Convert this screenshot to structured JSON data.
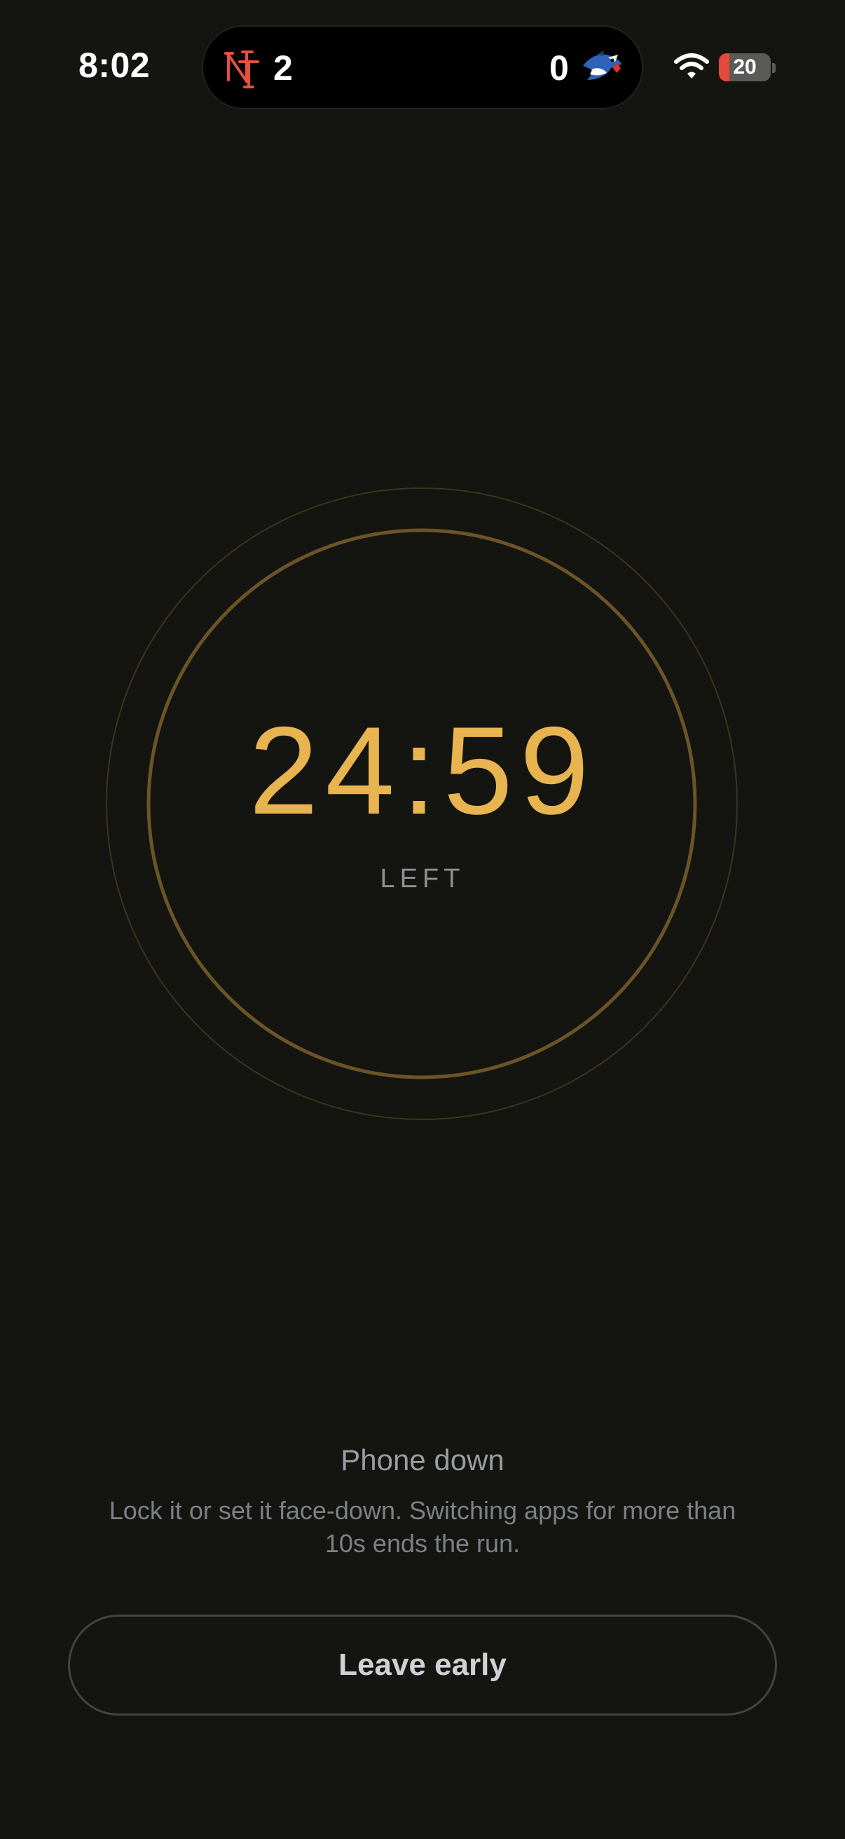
{
  "status_bar": {
    "time": "8:02",
    "wifi_icon": "wifi-icon",
    "battery_level": "20"
  },
  "live_activity": {
    "left_team_icon": "mets-logo",
    "left_score": "2",
    "right_score": "0",
    "right_team_icon": "blue-jays-logo"
  },
  "timer": {
    "value": "24:59",
    "caption": "LEFT",
    "accent_color": "#e8b44f"
  },
  "info": {
    "title": "Phone down",
    "body": "Lock it or set it face-down. Switching apps for more than 10s ends the run."
  },
  "actions": {
    "leave_label": "Leave early"
  }
}
